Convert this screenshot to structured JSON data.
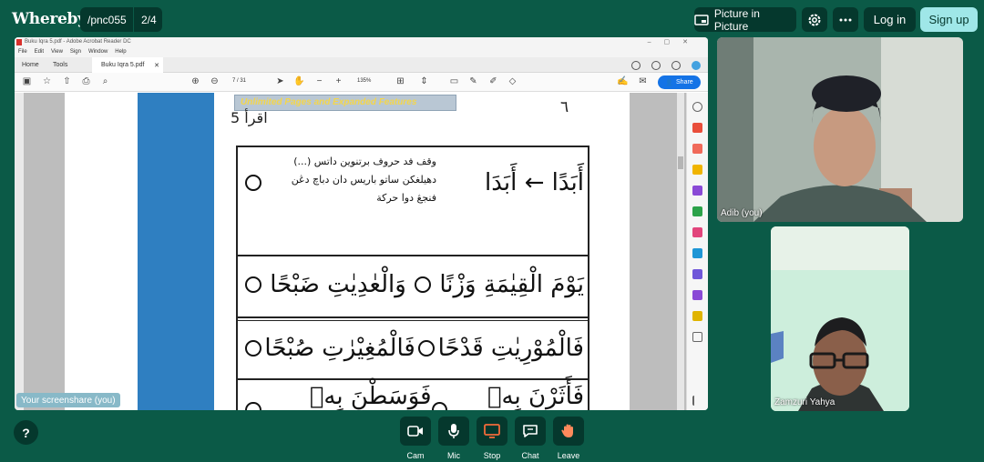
{
  "app": {
    "logo": "Whereby"
  },
  "room": {
    "name": "/pnc055",
    "count": "2/4"
  },
  "topbar": {
    "pip_label": "Picture in Picture",
    "login_label": "Log in",
    "signup_label": "Sign up"
  },
  "acrobat": {
    "window_title": "Buku Iqra 5.pdf - Adobe Acrobat Reader DC",
    "menu": [
      "File",
      "Edit",
      "View",
      "Sign",
      "Window",
      "Help"
    ],
    "tabs": {
      "home": "Home",
      "tools": "Tools",
      "doc": "Buku Iqra 5.pdf"
    },
    "page_current": "7",
    "page_total": "/ 31",
    "zoom": "135%",
    "share_label": "Share"
  },
  "document": {
    "banner": "Unlimited Pages and Expanded Features",
    "heading": "اقرأ 5",
    "page_number": "٦",
    "instructions": [
      "وقف فد حروف برتنوين داتس (...)",
      "دهيلغكن ساتو باريس دان دباچ دڠن",
      "فنجڠ دوا حركة"
    ],
    "rows": [
      [
        "أَبَدًا ← أَبَدَا"
      ],
      [
        "يَوْمَ الْقِيٰمَةِ وَزْنًا",
        "وَالْعٰدِيٰتِ ضَبْحًا"
      ],
      [
        "فَالْمُوْرِيٰتِ قَدْحًا",
        "فَالْمُغِيْرٰتِ صُبْحًا"
      ],
      [
        "فَأَثَرْنَ بِهٖ نَقْعًا",
        "فَوَسَطْنَ بِهٖ جَمْعًا"
      ]
    ]
  },
  "screenshare_label": "Your screenshare (you)",
  "participants": [
    {
      "name": "Adib (you)"
    },
    {
      "name": "Zamzuri Yahya"
    }
  ],
  "controls": [
    {
      "label": "Cam",
      "icon": "camera-icon"
    },
    {
      "label": "Mic",
      "icon": "microphone-icon"
    },
    {
      "label": "Stop",
      "icon": "stop-share-icon"
    },
    {
      "label": "Chat",
      "icon": "chat-icon"
    },
    {
      "label": "Leave",
      "icon": "leave-hand-icon"
    }
  ],
  "help_label": "?",
  "colors": {
    "background": "#0b5a47",
    "chip": "#05382d",
    "signup": "#9fe7e8",
    "stop_icon": "#f26b3a",
    "leave_icon": "#ff8a5c"
  }
}
